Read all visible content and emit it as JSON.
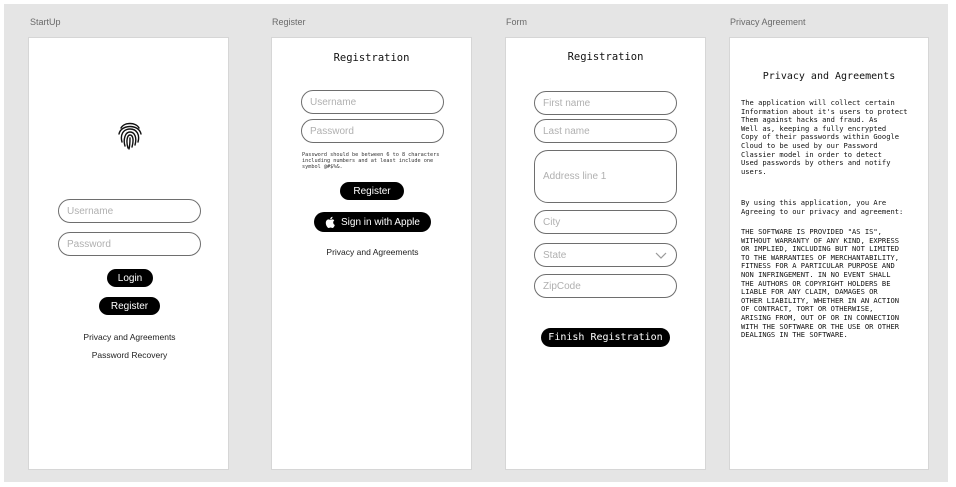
{
  "frames": {
    "startup": {
      "label": "StartUp"
    },
    "register": {
      "label": "Register"
    },
    "form": {
      "label": "Form"
    },
    "privacy": {
      "label": "Privacy Agreement"
    }
  },
  "startup": {
    "username_placeholder": "Username",
    "password_placeholder": "Password",
    "login_label": "Login",
    "register_label": "Register",
    "privacy_link": "Privacy and Agreements",
    "recovery_link": "Password Recovery",
    "icon": "fingerprint-icon"
  },
  "register": {
    "heading": "Registration",
    "username_placeholder": "Username",
    "password_placeholder": "Password",
    "password_hint": "Password should be between 6 to 8 characters including numbers and at least include one symbol @#$%&.",
    "register_label": "Register",
    "apple_label": "Sign in with Apple",
    "privacy_link": "Privacy and Agreements"
  },
  "form": {
    "heading": "Registration",
    "first_name": "First name",
    "last_name": "Last name",
    "address": "Address line 1",
    "city": "City",
    "state": "State",
    "zipcode": "ZipCode",
    "finish_label": "Finish Registration"
  },
  "privacy": {
    "heading": "Privacy and Agreements",
    "para1": "The application will collect certain\nInformation about it's users to protect\nThem against hacks and fraud. As\nWell as, keeping a fully encrypted\nCopy of their passwords within Google\nCloud to be used by our Password\nClassier model in order to detect\nUsed passwords by others and notify\nusers.",
    "para2": "By using this application, you Are\nAgreeing to our privacy and agreement:",
    "para3": "THE SOFTWARE IS PROVIDED \"AS IS\",\nWITHOUT WARRANTY OF ANY KIND, EXPRESS\nOR IMPLIED, INCLUDING BUT NOT LIMITED\nTO THE WARRANTIES OF MERCHANTABILITY,\nFITNESS FOR A PARTICULAR PURPOSE AND\nNON INFRINGEMENT. IN NO EVENT SHALL\nTHE AUTHORS OR COPYRIGHT HOLDERS BE\nLIABLE FOR ANY CLAIM, DAMAGES OR\nOTHER LIABILITY, WHETHER IN AN ACTION\nOF CONTRACT, TORT OR OTHERWISE,\nARISING FROM, OUT OF OR IN CONNECTION\nWITH THE SOFTWARE OR THE USE OR OTHER\nDEALINGS IN THE SOFTWARE."
  }
}
